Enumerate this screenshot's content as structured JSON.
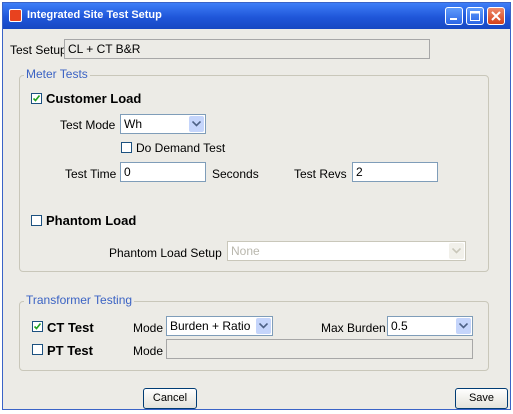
{
  "window": {
    "title": "Integrated Site Test Setup"
  },
  "test_setup": {
    "label": "Test Setup",
    "value": "CL + CT B&R"
  },
  "meter_tests": {
    "legend": "Meter Tests",
    "customer_load": {
      "label": "Customer Load",
      "checked": true
    },
    "test_mode": {
      "label": "Test Mode",
      "value": "Wh"
    },
    "demand_test": {
      "label": "Do Demand Test",
      "checked": false
    },
    "test_time": {
      "label": "Test Time",
      "value": "0",
      "unit": "Seconds"
    },
    "test_revs": {
      "label": "Test Revs",
      "value": "2"
    },
    "phantom_load": {
      "label": "Phantom Load",
      "checked": false
    },
    "phantom_setup": {
      "label": "Phantom Load Setup",
      "value": "None"
    }
  },
  "transformer_testing": {
    "legend": "Transformer Testing",
    "ct_test": {
      "label": "CT Test",
      "checked": true,
      "mode_label": "Mode",
      "mode_value": "Burden + Ratio",
      "max_burden_label": "Max Burden",
      "max_burden_value": "0.5"
    },
    "pt_test": {
      "label": "PT Test",
      "checked": false,
      "mode_label": "Mode",
      "mode_value": ""
    }
  },
  "buttons": {
    "cancel": "Cancel",
    "save": "Save"
  }
}
